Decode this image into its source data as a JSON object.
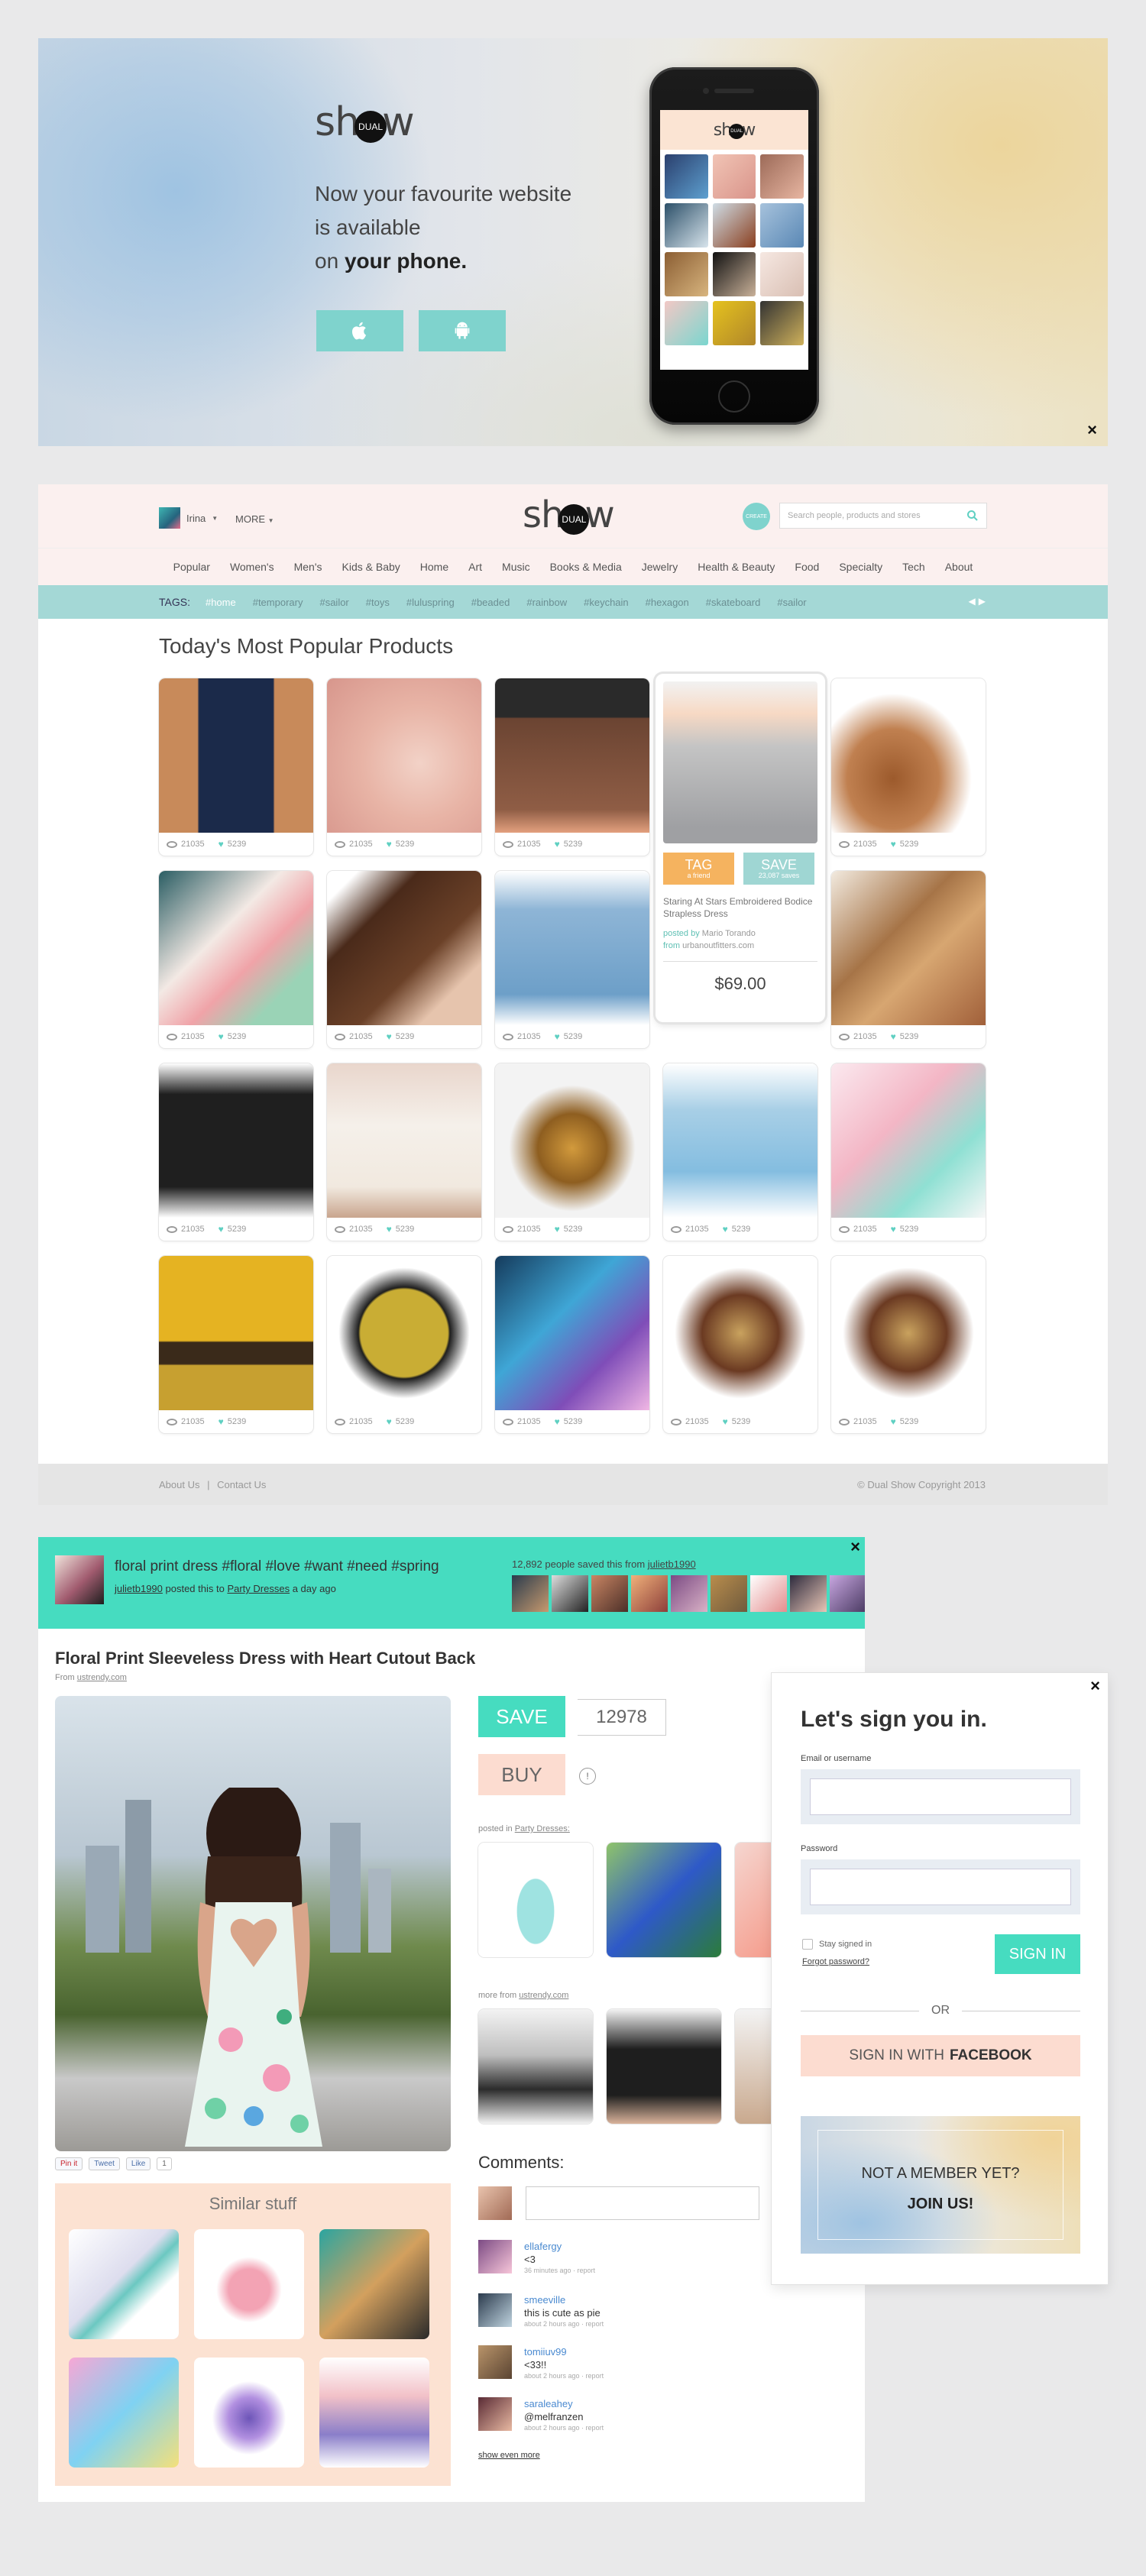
{
  "hero": {
    "logo_prefix": "sh",
    "logo_badge": "DUAL",
    "logo_suffix": "w",
    "tagline_line1": "Now your favourite website",
    "tagline_line2": "is available",
    "tagline_line3_pre": "on ",
    "tagline_line3_bold": "your phone.",
    "close_label": "×",
    "ios_icon": "apple-icon",
    "android_icon": "android-icon"
  },
  "shop": {
    "user_name": "Irina",
    "more_label": "MORE",
    "logo_prefix": "sh",
    "logo_badge": "DUAL",
    "logo_suffix": "w",
    "create_badge": "CREATE",
    "search_placeholder": "Search people, products and stores",
    "categories": [
      "Popular",
      "Women's",
      "Men's",
      "Kids & Baby",
      "Home",
      "Art",
      "Music",
      "Books & Media",
      "Jewelry",
      "Health & Beauty",
      "Food",
      "Specialty",
      "Tech",
      "About"
    ],
    "tags_label": "TAGS:",
    "tags": [
      "#home",
      "#temporary",
      "#sailor",
      "#toys",
      "#luluspring",
      "#beaded",
      "#rainbow",
      "#keychain",
      "#hexagon",
      "#skateboard",
      "#sailor"
    ],
    "section_title": "Today's Most Popular  Products",
    "view_count": "21035",
    "save_count": "5239",
    "detail": {
      "tag_label": "TAG",
      "tag_sub": "a friend",
      "save_label": "SAVE",
      "save_sub": "23,087 saves",
      "title": "Staring At Stars Embroidered Bodice Strapless Dress",
      "posted_prefix": "posted by",
      "posted_by": "Mario Torando",
      "from_prefix": "from",
      "from_site": "urbanoutfitters.com",
      "price": "$69.00"
    },
    "footer_about": "About Us",
    "footer_sep": "|",
    "footer_contact": "Contact Us",
    "copyright": "© Dual Show Copyright 2013"
  },
  "item": {
    "banner_title": "floral print dress",
    "banner_hashtags": " #floral #love #want #need #spring",
    "banner_user": "julietb1990",
    "banner_posted": " posted this to ",
    "banner_board": "Party Dresses",
    "banner_when": " a day ago",
    "saved_count": "12,892 people saved this from ",
    "saved_from": "julietb1990",
    "close_label": "×",
    "title": "Floral Print Sleeveless Dress with Heart Cutout Back",
    "from_prefix": "From ",
    "from_site": "ustrendy.com",
    "share_pin": "Pin it",
    "share_tweet": "Tweet",
    "share_like": "Like",
    "share_count": "1",
    "similar_title": "Similar stuff",
    "save_label": "SAVE",
    "save_count": "12978",
    "buy_label": "BUY",
    "info_label": "!",
    "posted_in_prefix": "posted in ",
    "posted_in_board": "Party Dresses:",
    "more_from_prefix": "more from ",
    "more_from_site": "ustrendy.com",
    "comments_title": "Comments:",
    "comments": [
      {
        "user": "ellafergy",
        "text": "<3",
        "meta": "36 minutes ago · report"
      },
      {
        "user": "smeeville",
        "text": "this is cute as pie",
        "meta": "about 2 hours ago · report"
      },
      {
        "user": "tomiiuv99",
        "text": "<33!!",
        "meta": "about 2 hours ago · report"
      },
      {
        "user": "saraleahey",
        "text": "@melfranzen",
        "meta": "about 2 hours ago · report"
      }
    ],
    "show_more": "show even more"
  },
  "signin": {
    "close_label": "×",
    "title": "Let's sign you in.",
    "email_label": "Email or username",
    "password_label": "Password",
    "stay_label": "Stay signed in",
    "forgot_label": "Forgot password?",
    "submit_label": "SIGN IN",
    "or_label": "OR",
    "fb_pre": "SIGN IN WITH",
    "fb_bold": "FACEBOOK",
    "join_question": "NOT A MEMBER YET?",
    "join_action": "JOIN US!"
  },
  "colors": {
    "accent": "#46dcc0",
    "accent_soft": "#7fd3cd",
    "peach": "#fcdcd0",
    "tag_bar": "#a4d8d6",
    "tag_orange": "#f5b35f"
  }
}
